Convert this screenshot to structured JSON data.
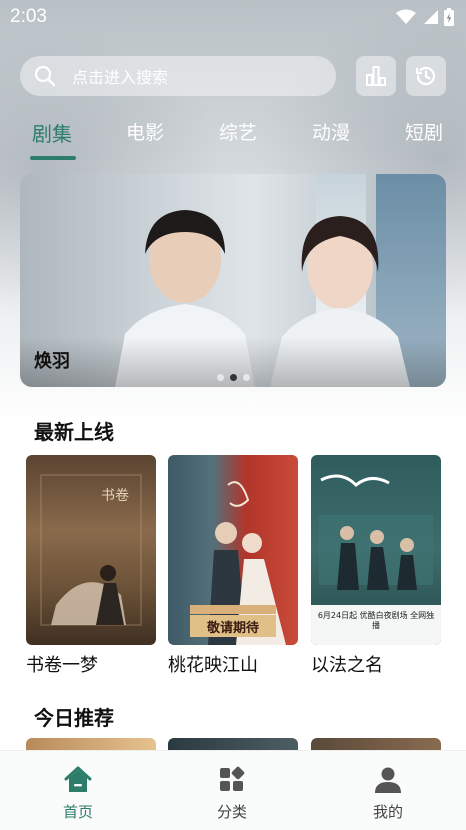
{
  "status_bar": {
    "time": "2:03"
  },
  "search": {
    "placeholder": "点击进入搜索"
  },
  "tabs": [
    {
      "label": "剧集",
      "active": true
    },
    {
      "label": "电影"
    },
    {
      "label": "综艺"
    },
    {
      "label": "动漫"
    },
    {
      "label": "短剧"
    }
  ],
  "banner": {
    "title": "焕羽",
    "slide_index": 1,
    "slide_count": 3
  },
  "sections": {
    "latest": {
      "title": "最新上线",
      "items": [
        {
          "title": "书卷一梦"
        },
        {
          "title": "桃花映江山",
          "poster_text": "敬请期待"
        },
        {
          "title": "以法之名",
          "poster_text": "6月24日起 优酷白夜剧场 全网独播"
        }
      ]
    },
    "recommend": {
      "title": "今日推荐"
    }
  },
  "bottom_nav": [
    {
      "label": "首页",
      "icon": "home-icon",
      "active": true
    },
    {
      "label": "分类",
      "icon": "category-icon"
    },
    {
      "label": "我的",
      "icon": "profile-icon"
    }
  ],
  "colors": {
    "accent": "#2e7d6b"
  }
}
